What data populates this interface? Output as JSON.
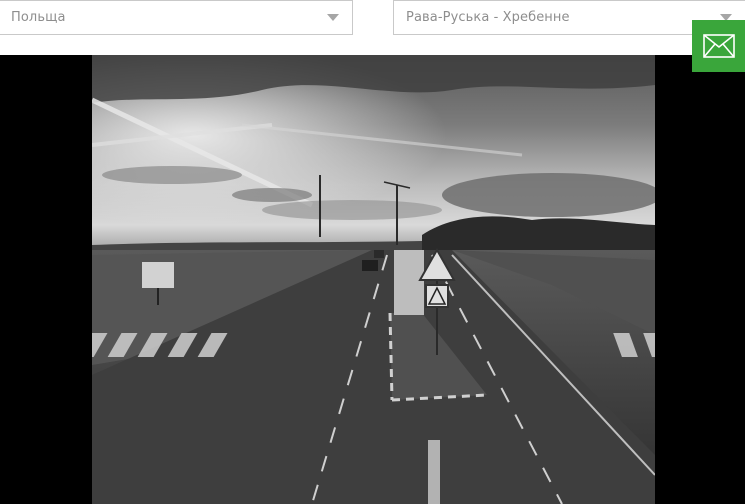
{
  "filters": {
    "country": {
      "value": "Польща"
    },
    "checkpoint": {
      "value": "Рава-Руська - Хребенне"
    }
  },
  "contact": {
    "icon": "envelope-icon"
  },
  "camera": {
    "image_type": "grayscale webcam view of border checkpoint road"
  }
}
